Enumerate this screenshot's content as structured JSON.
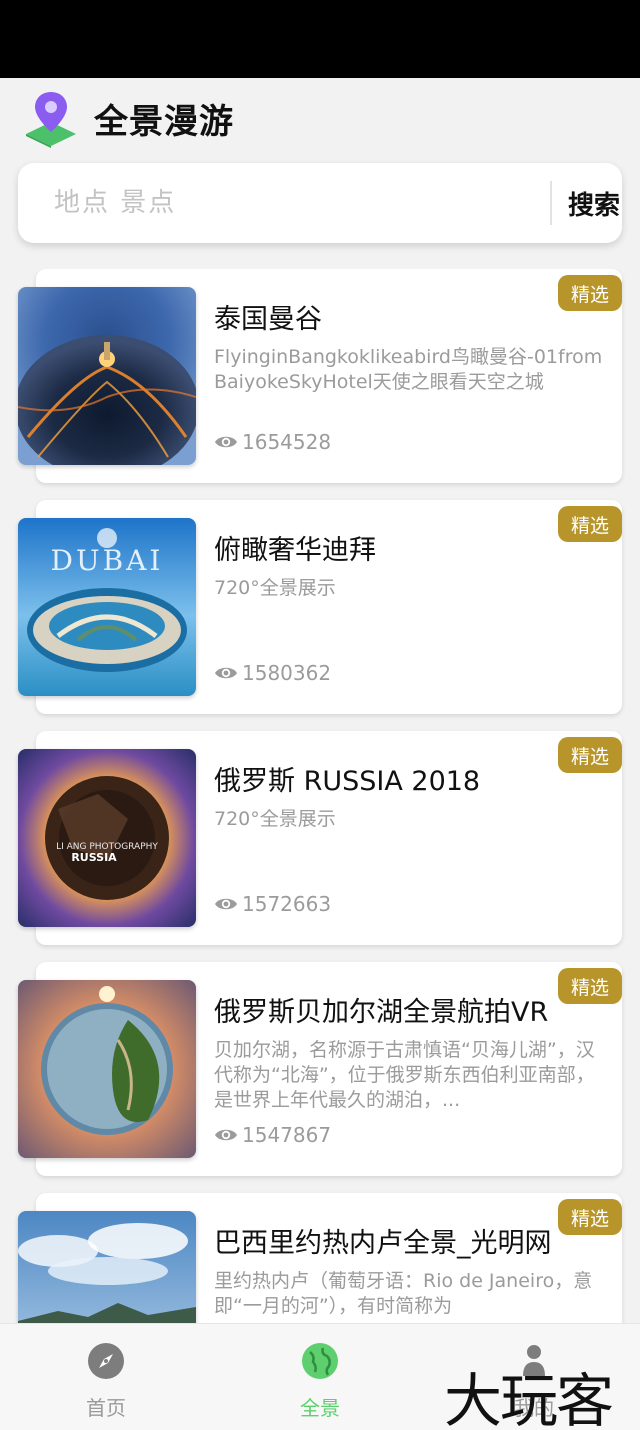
{
  "header": {
    "title": "全景漫游"
  },
  "search": {
    "placeholder": "地点 景点",
    "button_label": "搜索"
  },
  "items": [
    {
      "title": "泰国曼谷",
      "description": "FlyinginBangkoklikeabird鸟瞰曼谷-01fromBaiyokeSkyHotel天使之眼看天空之城",
      "views": "1654528",
      "badge": "精选"
    },
    {
      "title": "俯瞰奢华迪拜",
      "description": "720°全景展示",
      "views": "1580362",
      "badge": "精选",
      "image_text": "DUBAI"
    },
    {
      "title": "俄罗斯 RUSSIA 2018",
      "description": "720°全景展示",
      "views": "1572663",
      "badge": "精选",
      "image_text_1": "LI ANG PHOTOGRAPHY",
      "image_text_2": "RUSSIA"
    },
    {
      "title": "俄罗斯贝加尔湖全景航拍VR",
      "description": "贝加尔湖，名称源于古肃慎语“贝海儿湖”，汉代称为“北海”，位于俄罗斯东西伯利亚南部，是世界上年代最久的湖泊，...",
      "views": "1547867",
      "badge": "精选"
    },
    {
      "title": "巴西里约热内卢全景_光明网",
      "description": "里约热内卢（葡萄牙语：Rio de Janeiro，意即“一月的河”），有时简称为",
      "views": "",
      "badge": "精选"
    }
  ],
  "nav": [
    {
      "label": "首页",
      "icon": "compass-icon"
    },
    {
      "label": "全景",
      "icon": "globe-icon"
    },
    {
      "label": "我的",
      "icon": "person-icon"
    }
  ],
  "watermark": "大玩客",
  "colors": {
    "accent_green": "#5ecf6e",
    "badge_gold": "#b8952b"
  }
}
